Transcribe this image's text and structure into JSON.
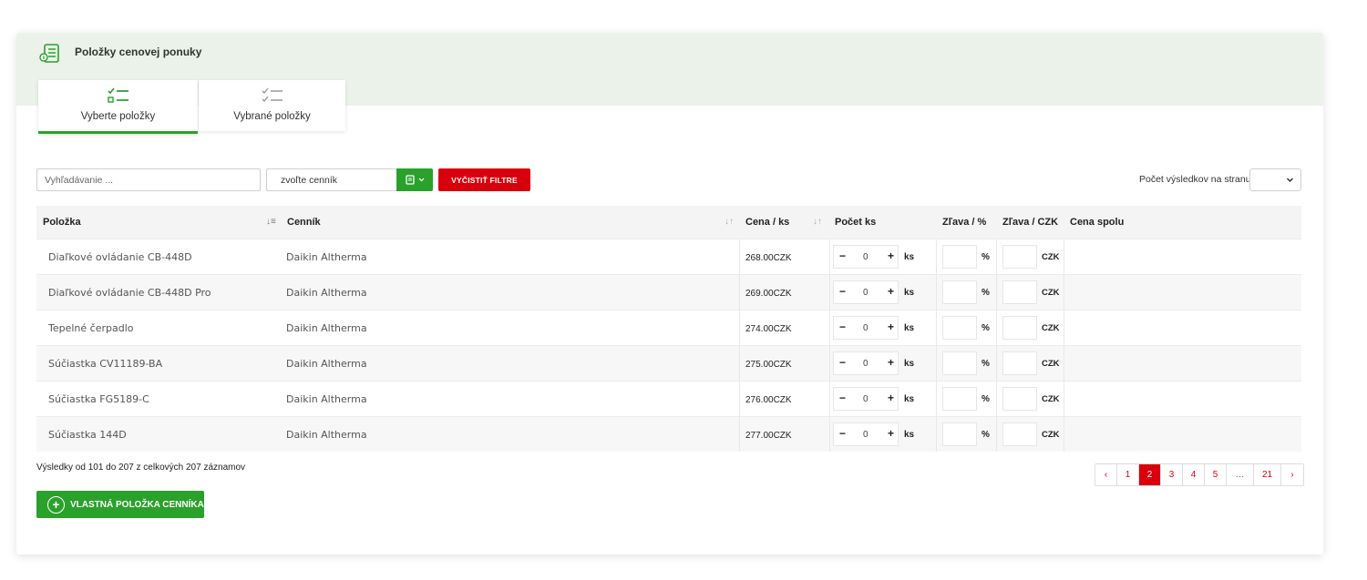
{
  "header": {
    "title": "Položky cenovej ponuky"
  },
  "tabs": [
    {
      "label": "Vyberte položky",
      "active": true
    },
    {
      "label": "Vybrané položky",
      "active": false
    }
  ],
  "filters": {
    "search_placeholder": "Vyhľadávanie ...",
    "pricelist_value": "zvoľte cenník",
    "clear_label": "VYČISTIŤ FILTRE",
    "per_page_label": "Počet výsledkov na stranu"
  },
  "table": {
    "columns": [
      "Položka",
      "Cenník",
      "Cena / ks",
      "Počet ks",
      "Zľava / %",
      "Zľava / CZK",
      "Cena spolu"
    ],
    "units": {
      "qty": "ks",
      "pct": "%",
      "czk": "CZK"
    },
    "qty_minus": "−",
    "qty_plus": "+",
    "rows": [
      {
        "item": "Diaľkové ovládanie CB-448D",
        "pricelist": "Daikin Altherma",
        "price": "268.00CZK",
        "qty": "0"
      },
      {
        "item": "Diaľkové ovládanie CB-448D Pro",
        "pricelist": "Daikin Altherma",
        "price": "269.00CZK",
        "qty": "0"
      },
      {
        "item": "Tepelné čerpadlo",
        "pricelist": "Daikin Altherma",
        "price": "274.00CZK",
        "qty": "0"
      },
      {
        "item": "Súčiastka CV11189-BA",
        "pricelist": "Daikin Altherma",
        "price": "275.00CZK",
        "qty": "0"
      },
      {
        "item": "Súčiastka FG5189-C",
        "pricelist": "Daikin Altherma",
        "price": "276.00CZK",
        "qty": "0"
      },
      {
        "item": "Súčiastka 144D",
        "pricelist": "Daikin Altherma",
        "price": "277.00CZK",
        "qty": "0"
      }
    ]
  },
  "results_info": "Výsledky od 101 do 207 z celkových 207 záznamov",
  "pagination": {
    "prev": "‹",
    "pages": [
      "1",
      "2",
      "3",
      "4",
      "5",
      "…",
      "21"
    ],
    "current": "2",
    "next": "›"
  },
  "custom_item_label": "VLASTNÁ POLOŽKA CENNÍKA",
  "colors": {
    "accent_green": "#2aa12b",
    "accent_red": "#d9000d",
    "header_bg": "#ebf2ea"
  }
}
